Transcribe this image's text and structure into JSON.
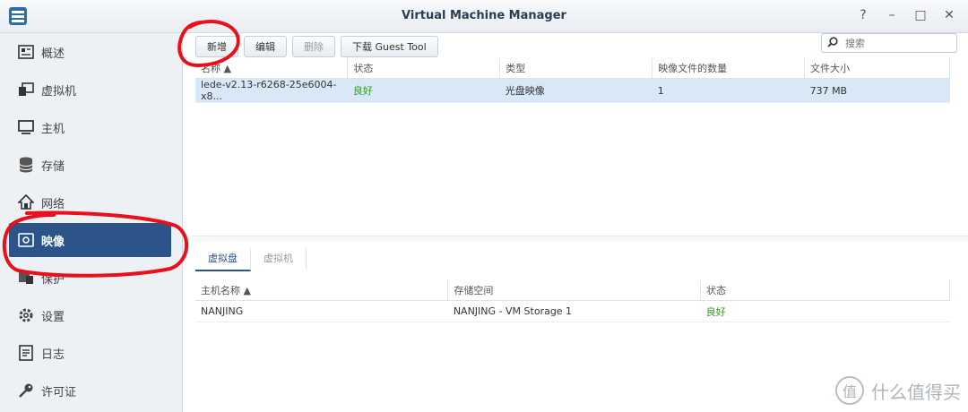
{
  "window": {
    "title": "Virtual Machine Manager",
    "controls": [
      "?",
      "–",
      "□",
      "✕"
    ]
  },
  "sidebar": {
    "items": [
      {
        "label": "概述",
        "icon": "overview-icon"
      },
      {
        "label": "虚拟机",
        "icon": "vm-icon"
      },
      {
        "label": "主机",
        "icon": "host-icon"
      },
      {
        "label": "存储",
        "icon": "storage-icon"
      },
      {
        "label": "网络",
        "icon": "network-icon"
      },
      {
        "label": "映像",
        "icon": "image-icon",
        "active": true
      },
      {
        "label": "保护",
        "icon": "protection-icon"
      },
      {
        "label": "设置",
        "icon": "settings-icon"
      },
      {
        "label": "日志",
        "icon": "log-icon"
      },
      {
        "label": "许可证",
        "icon": "license-icon"
      }
    ]
  },
  "toolbar": {
    "new_label": "新增",
    "edit_label": "编辑",
    "delete_label": "删除",
    "download_label": "下载 Guest Tool",
    "search_placeholder": "搜索"
  },
  "images_table": {
    "columns": [
      "名称 ▲",
      "状态",
      "类型",
      "映像文件的数量",
      "文件大小"
    ],
    "rows": [
      {
        "name": "lede-v2.13-r6268-25e6004-x8...",
        "status": "良好",
        "type": "光盘映像",
        "count": "1",
        "size": "737 MB"
      }
    ]
  },
  "detail_tabs": {
    "tab1": "虚拟盘",
    "tab2": "虚拟机"
  },
  "detail_table": {
    "columns": [
      "主机名称 ▲",
      "存储空间",
      "状态"
    ],
    "rows": [
      {
        "host": "NANJING",
        "storage": "NANJING - VM Storage 1",
        "status": "良好"
      }
    ]
  },
  "watermark": {
    "badge": "值",
    "text": "什么值得买"
  },
  "colors": {
    "accent": "#2c5488",
    "ok": "#3a9a2a",
    "annotation": "#e8101a"
  }
}
